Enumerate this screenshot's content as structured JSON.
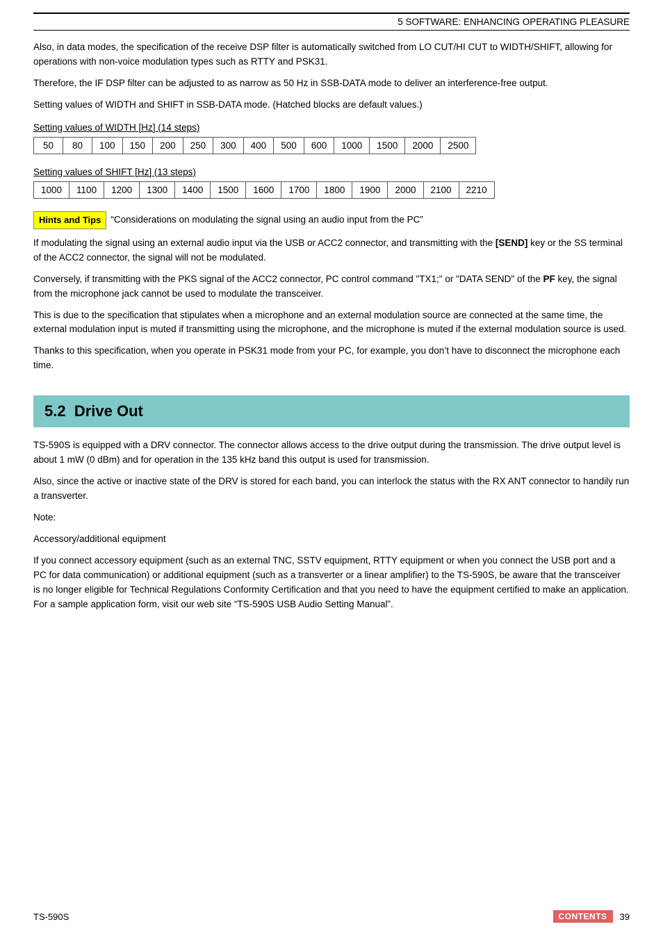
{
  "header": {
    "title": "5 SOFTWARE: ENHANCING OPERATING PLEASURE"
  },
  "intro_paragraphs": [
    "Also, in data modes, the specification of the receive DSP filter is automatically switched from LO CUT/HI CUT to WIDTH/SHIFT, allowing for operations with non-voice modulation types such as RTTY and PSK31.",
    "Therefore, the IF DSP filter can be adjusted to as narrow as 50 Hz in SSB-DATA mode to deliver an interference-free output.",
    "Setting values of WIDTH and SHIFT in SSB-DATA mode.  (Hatched blocks are default values.)"
  ],
  "width_table": {
    "label": "Setting values of WIDTH [Hz] (14 steps)",
    "values": [
      "50",
      "80",
      "100",
      "150",
      "200",
      "250",
      "300",
      "400",
      "500",
      "600",
      "1000",
      "1500",
      "2000",
      "2500"
    ]
  },
  "shift_table": {
    "label": "Setting values of SHIFT [Hz] (13 steps)",
    "values": [
      "1000",
      "1100",
      "1200",
      "1300",
      "1400",
      "1500",
      "1600",
      "1700",
      "1800",
      "1900",
      "2000",
      "2100",
      "2210"
    ]
  },
  "hints": {
    "label": "Hints and Tips",
    "quote": "“Considerations on modulating the signal using an audio input from the PC”"
  },
  "hints_paragraphs": [
    "If modulating the signal using an external audio input via the USB or ACC2 connector, and transmitting with the [SEND] key or the SS terminal of the ACC2 connector, the signal will not be modulated.",
    "Conversely, if transmitting with the PKS signal of the ACC2 connector, PC control command “TX1;” or “DATA SEND” of the PF key, the signal from the microphone jack cannot be used to modulate the transceiver.",
    "This is due to the specification that stipulates when a microphone and an external modulation source are connected at the same time, the external modulation input is muted if transmitting using the microphone, and the microphone is muted if the external modulation source is used.",
    "Thanks to this specification, when you operate in PSK31 mode from your PC, for example, you don’t have to disconnect the microphone each time."
  ],
  "section52": {
    "number": "5.2",
    "title": "Drive Out"
  },
  "section52_paragraphs": [
    "TS-590S is equipped with a DRV connector.  The connector allows access to the drive output during the transmission.  The drive output level is about 1 mW (0 dBm) and for operation in the 135 kHz band this output is used for transmission.",
    "Also, since the active or inactive state of the DRV is stored for each band, you can interlock the status with the RX ANT connector to handily run a transverter."
  ],
  "note_label": "Note:",
  "accessory_label": "Accessory/additional equipment",
  "accessory_paragraph": "If you connect accessory equipment (such as an external TNC, SSTV equipment, RTTY equipment or when you connect the USB port and a PC for data communication) or additional equipment (such as a transverter or a linear amplifier) to the TS-590S, be aware that the transceiver is no longer eligible for Technical Regulations Conformity Certification and that you need to have the equipment certified to make an application.  For a sample application form, visit our web site “TS-590S USB Audio Setting Manual”.",
  "footer": {
    "model": "TS-590S",
    "contents_label": "CONTENTS",
    "page_number": "39"
  }
}
